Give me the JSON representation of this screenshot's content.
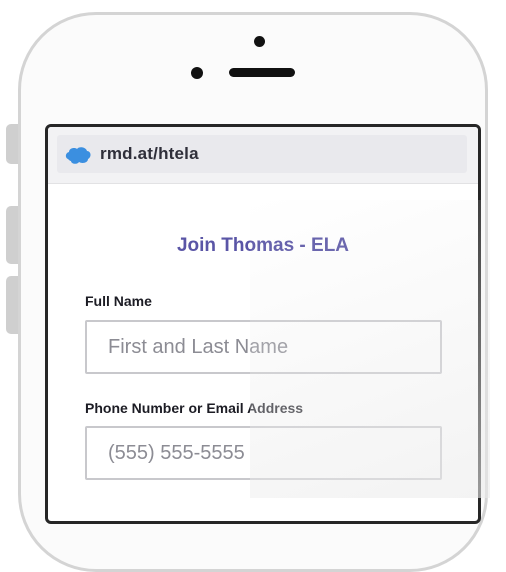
{
  "browser": {
    "url": "rmd.at/htela"
  },
  "form": {
    "title": "Join Thomas - ELA",
    "full_name": {
      "label": "Full Name",
      "placeholder": "First and Last Name"
    },
    "contact": {
      "label": "Phone Number or Email Address",
      "placeholder": "(555) 555-5555"
    }
  },
  "colors": {
    "title": "#5a55a6",
    "brand_icon": "#3b8fe0"
  },
  "icons": {
    "brand": "brain-icon"
  }
}
